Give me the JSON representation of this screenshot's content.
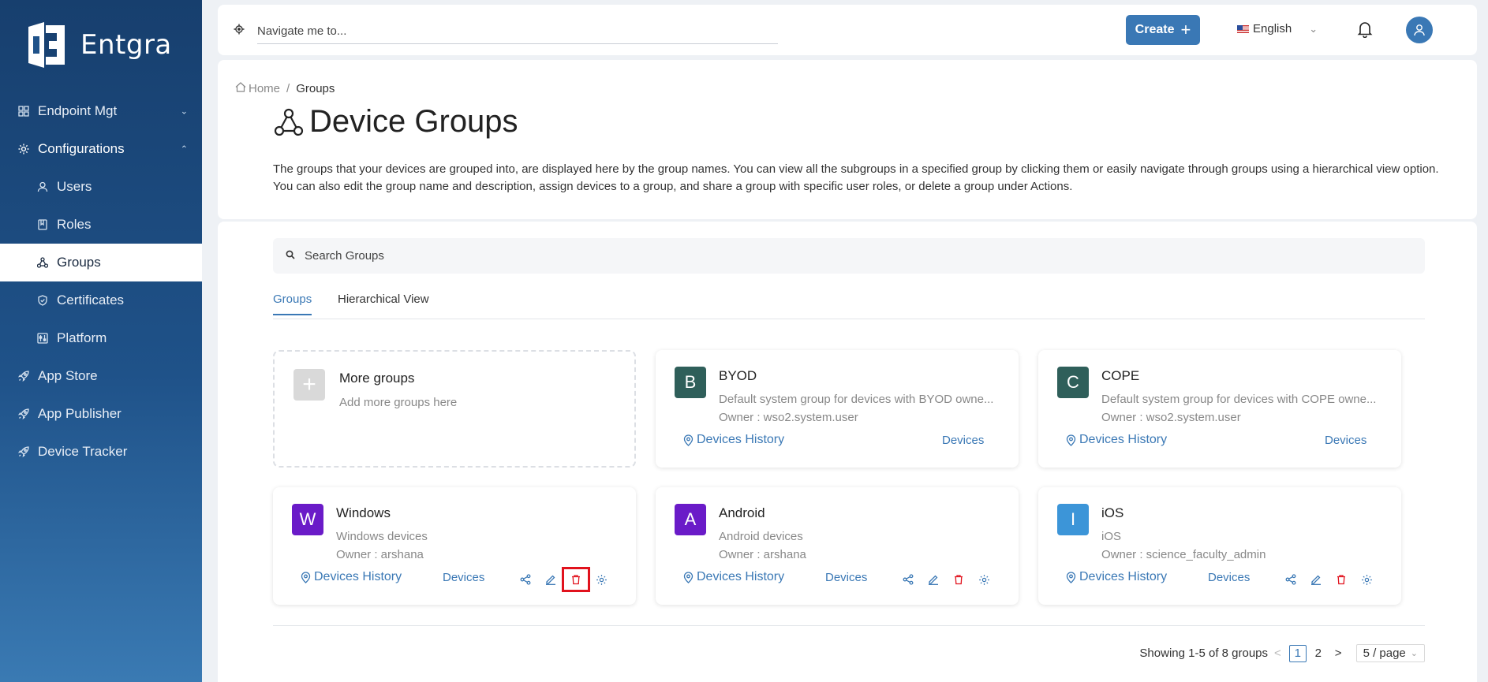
{
  "app": {
    "brand": "Entgra"
  },
  "sidebar": {
    "items": [
      {
        "label": "Endpoint Mgt",
        "icon": "grid-icon"
      },
      {
        "label": "Configurations",
        "icon": "gear-icon"
      },
      {
        "label": "Users",
        "icon": "user-icon"
      },
      {
        "label": "Roles",
        "icon": "book-icon"
      },
      {
        "label": "Groups",
        "icon": "groups-icon"
      },
      {
        "label": "Certificates",
        "icon": "shield-icon"
      },
      {
        "label": "Platform",
        "icon": "sliders-icon"
      },
      {
        "label": "App Store",
        "icon": "rocket-icon"
      },
      {
        "label": "App Publisher",
        "icon": "rocket-icon"
      },
      {
        "label": "Device Tracker",
        "icon": "rocket-icon"
      }
    ]
  },
  "topbar": {
    "navigate_placeholder": "Navigate me to...",
    "create_label": "Create",
    "language": "English"
  },
  "breadcrumb": {
    "home": "Home",
    "current": "Groups"
  },
  "page": {
    "title": "Device Groups",
    "description": "The groups that your devices are grouped into, are displayed here by the group names. You can view all the subgroups in a specified group by clicking them or easily navigate through groups using a hierarchical view option. You can also edit the group name and description, assign devices to a group, and share a group with specific user roles, or delete a group under Actions."
  },
  "search": {
    "placeholder": "Search Groups"
  },
  "tabs": [
    {
      "label": "Groups"
    },
    {
      "label": "Hierarchical View"
    }
  ],
  "add_card": {
    "title": "More groups",
    "subtitle": "Add more groups here"
  },
  "groups": [
    {
      "letter": "B",
      "color": "#2f5f5a",
      "name": "BYOD",
      "description": "Default system group for devices with BYOD owne...",
      "owner": "Owner : wso2.system.user",
      "history_label": "Devices History",
      "devices_label": "Devices"
    },
    {
      "letter": "C",
      "color": "#2f5f5a",
      "name": "COPE",
      "description": "Default system group for devices with COPE owne...",
      "owner": "Owner : wso2.system.user",
      "history_label": "Devices History",
      "devices_label": "Devices"
    },
    {
      "letter": "W",
      "color": "#6a1bc8",
      "name": "Windows",
      "description": "Windows devices",
      "owner": "Owner : arshana",
      "history_label": "Devices History",
      "devices_label": "Devices"
    },
    {
      "letter": "A",
      "color": "#6a1bc8",
      "name": "Android",
      "description": "Android devices",
      "owner": "Owner : arshana",
      "history_label": "Devices History",
      "devices_label": "Devices"
    },
    {
      "letter": "I",
      "color": "#3c95d8",
      "name": "iOS",
      "description": "iOS",
      "owner": "Owner : science_faculty_admin",
      "history_label": "Devices History",
      "devices_label": "Devices"
    }
  ],
  "pagination": {
    "summary": "Showing 1-5 of 8 groups",
    "pages": [
      "1",
      "2"
    ],
    "current": "1",
    "page_size": "5 / page"
  },
  "colors": {
    "accent": "#3a78b5",
    "danger": "#e1121d",
    "sidebar": "#1f5289"
  }
}
